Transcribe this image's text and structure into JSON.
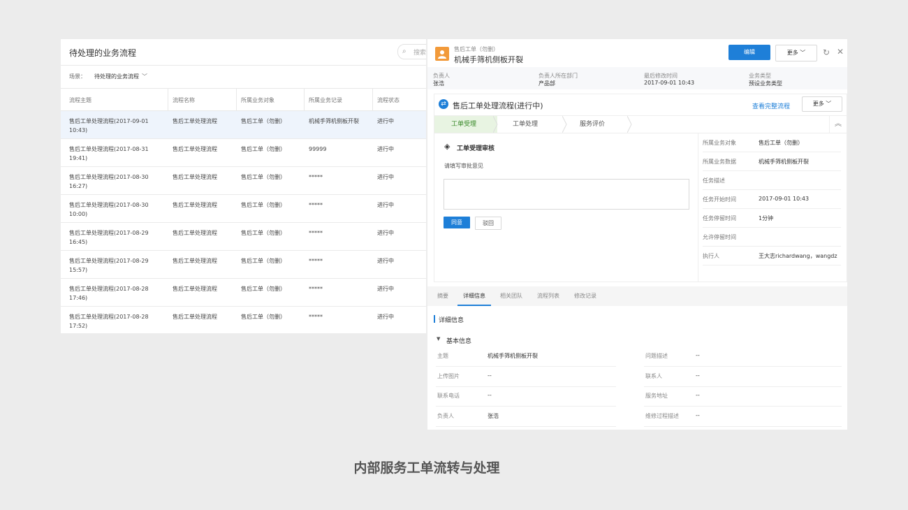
{
  "left": {
    "title": "待处理的业务流程",
    "search_placeholder": "搜索",
    "scene_label": "场景：",
    "scene_value": "待处理的业务流程",
    "columns": [
      "流程主题",
      "流程名称",
      "所属业务对象",
      "所属业务记录",
      "流程状态"
    ],
    "rows": [
      {
        "topic": "售后工单处理流程(2017-09-01 10:43)",
        "name": "售后工单处理流程",
        "object": "售后工单（勿删）",
        "record": "机械手筛机侧板开裂",
        "status": "进行中"
      },
      {
        "topic": "售后工单处理流程(2017-08-31 19:41)",
        "name": "售后工单处理流程",
        "object": "售后工单（勿删）",
        "record": "99999",
        "status": "进行中"
      },
      {
        "topic": "售后工单处理流程(2017-08-30 16:27)",
        "name": "售后工单处理流程",
        "object": "售后工单（勿删）",
        "record": "*****",
        "status": "进行中"
      },
      {
        "topic": "售后工单处理流程(2017-08-30 10:00)",
        "name": "售后工单处理流程",
        "object": "售后工单（勿删）",
        "record": "*****",
        "status": "进行中"
      },
      {
        "topic": "售后工单处理流程(2017-08-29 16:45)",
        "name": "售后工单处理流程",
        "object": "售后工单（勿删）",
        "record": "*****",
        "status": "进行中"
      },
      {
        "topic": "售后工单处理流程(2017-08-29 15:57)",
        "name": "售后工单处理流程",
        "object": "售后工单（勿删）",
        "record": "*****",
        "status": "进行中"
      },
      {
        "topic": "售后工单处理流程(2017-08-28 17:46)",
        "name": "售后工单处理流程",
        "object": "售后工单（勿删）",
        "record": "*****",
        "status": "进行中"
      },
      {
        "topic": "售后工单处理流程(2017-08-28 17:52)",
        "name": "售后工单处理流程",
        "object": "售后工单（勿删）",
        "record": "*****",
        "status": "进行中"
      }
    ]
  },
  "right": {
    "subtitle": "售后工单（勿删）",
    "title": "机械手筛机侧板开裂",
    "edit_label": "编辑",
    "more_label": "更多",
    "meta": [
      {
        "label": "负责人",
        "value": "张浩"
      },
      {
        "label": "负责人所在部门",
        "value": "产品部"
      },
      {
        "label": "最后修改时间",
        "value": "2017-09-01 10:43"
      },
      {
        "label": "业务类型",
        "value": "预设业务类型"
      }
    ],
    "flow": {
      "title": "售后工单处理流程(进行中)",
      "link": "查看完整流程",
      "more_label": "更多",
      "steps": [
        "工单受理",
        "工单处理",
        "服务评价"
      ],
      "review_title": "工单受理审核",
      "review_hint": "请填写审批意见",
      "agree_label": "同意",
      "reject_label": "驳回",
      "side": [
        {
          "k": "所属业务对象",
          "v": "售后工单（勿删）"
        },
        {
          "k": "所属业务数据",
          "v": "机械手筛机侧板开裂"
        },
        {
          "k": "任务描述",
          "v": ""
        },
        {
          "k": "任务开始时间",
          "v": "2017-09-01 10:43"
        },
        {
          "k": "任务停留时间",
          "v": "1分钟"
        },
        {
          "k": "允许停留时间",
          "v": ""
        },
        {
          "k": "执行人",
          "v": "王大志richardwang，wangdz"
        }
      ]
    },
    "tabs": [
      "摘要",
      "详细信息",
      "相关团队",
      "流程列表",
      "修改记录"
    ],
    "detail_title": "详细信息",
    "basic_title": "基本信息",
    "details_left": [
      {
        "k": "主题",
        "v": "机械手筛机侧板开裂"
      },
      {
        "k": "上传图片",
        "v": "--"
      },
      {
        "k": "联系电话",
        "v": "--"
      },
      {
        "k": "负责人",
        "v": "张浩"
      }
    ],
    "details_right": [
      {
        "k": "问题描述",
        "v": "--"
      },
      {
        "k": "联系人",
        "v": "--"
      },
      {
        "k": "服务地址",
        "v": "--"
      },
      {
        "k": "维修过程描述",
        "v": "--"
      }
    ]
  },
  "caption": "内部服务工单流转与处理"
}
